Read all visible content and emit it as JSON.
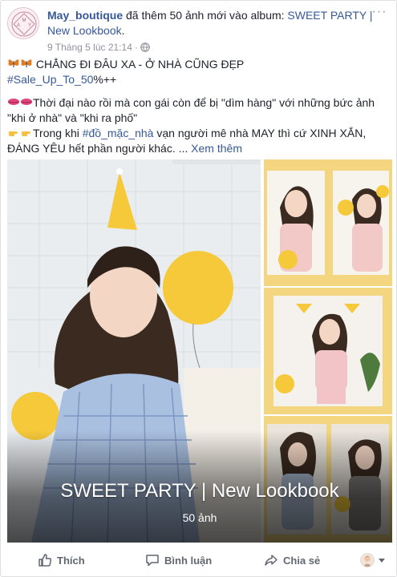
{
  "header": {
    "author": "May_boutique",
    "action": " đã thêm 50 ảnh mới vào album: ",
    "album_link": "SWEET PARTY | New Lookbook",
    "after_link": ".",
    "timestamp": "9 Tháng 5 lúc 21:14",
    "dot": "·",
    "avatar_letters": "MAY"
  },
  "post_text": {
    "line1": "CHẲNG ĐI ĐÂU XA - Ở NHÀ CŨNG ĐẸP",
    "hashtag1": "#Sale_Up_To_50",
    "hashtag1_suffix": "%++",
    "para2": "Thời đại nào rồi mà con gái còn để bị \"dìm hàng\" với những bức ảnh \"khi ở nhà\" và \"khi ra phố\"",
    "para3_before": "Trong khi ",
    "hashtag2": "#đồ_mặc_nhà",
    "para3_after": " vạn người mê nhà MAY thì cứ XINH XẮN, ĐÁNG YÊU hết phần người khác. ...",
    "see_more": " Xem thêm"
  },
  "album": {
    "title": "SWEET PARTY | New Lookbook",
    "count": "50 ảnh"
  },
  "actions": {
    "like": "Thích",
    "comment": "Bình luận",
    "share": "Chia sẻ"
  },
  "colors": {
    "link": "#365899",
    "muted": "#90949c",
    "balloon": "#f6c93b",
    "wall": "#e9edf0"
  }
}
